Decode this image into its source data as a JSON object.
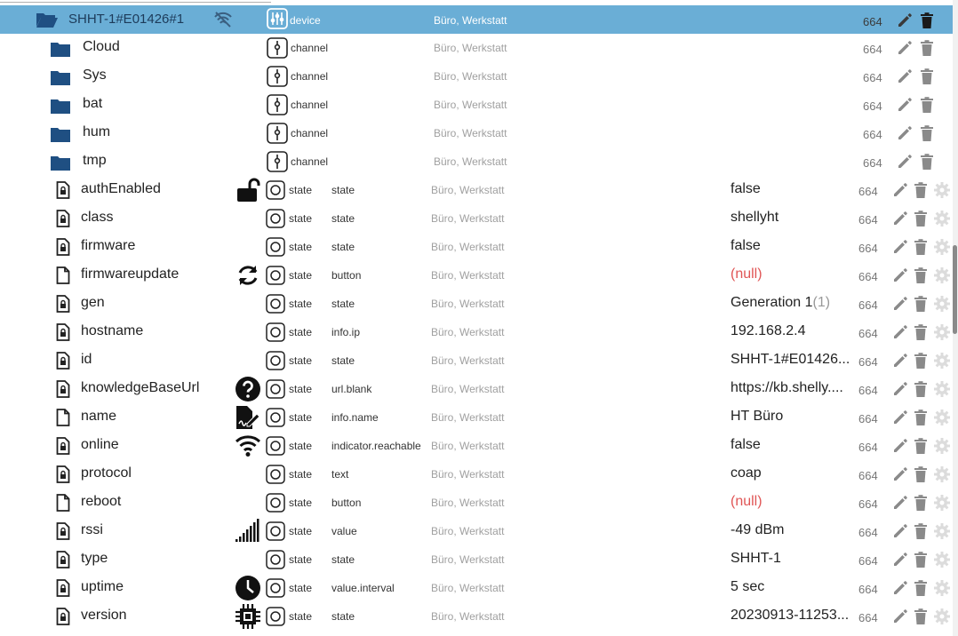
{
  "device": {
    "name": "SHHT-1#E01426#1",
    "type": "device",
    "room": "Büro, Werkstatt",
    "acl": "664"
  },
  "channels": [
    {
      "name": "Cloud",
      "type": "channel",
      "room": "Büro, Werkstatt",
      "acl": "664"
    },
    {
      "name": "Sys",
      "type": "channel",
      "room": "Büro, Werkstatt",
      "acl": "664"
    },
    {
      "name": "bat",
      "type": "channel",
      "room": "Büro, Werkstatt",
      "acl": "664"
    },
    {
      "name": "hum",
      "type": "channel",
      "room": "Büro, Werkstatt",
      "acl": "664"
    },
    {
      "name": "tmp",
      "type": "channel",
      "room": "Büro, Werkstatt",
      "acl": "664"
    }
  ],
  "states": [
    {
      "name": "authEnabled",
      "locked": true,
      "icon": "lock-open-icon",
      "type": "state",
      "role": "state",
      "room": "Büro, Werkstatt",
      "value": "false",
      "value_suffix": "",
      "null": false,
      "acl": "664"
    },
    {
      "name": "class",
      "locked": true,
      "icon": "",
      "type": "state",
      "role": "state",
      "room": "Büro, Werkstatt",
      "value": "shellyht",
      "value_suffix": "",
      "null": false,
      "acl": "664"
    },
    {
      "name": "firmware",
      "locked": true,
      "icon": "",
      "type": "state",
      "role": "state",
      "room": "Büro, Werkstatt",
      "value": "false",
      "value_suffix": "",
      "null": false,
      "acl": "664"
    },
    {
      "name": "firmwareupdate",
      "locked": false,
      "icon": "refresh-icon",
      "type": "state",
      "role": "button",
      "room": "Büro, Werkstatt",
      "value": "(null)",
      "value_suffix": "",
      "null": true,
      "acl": "664"
    },
    {
      "name": "gen",
      "locked": true,
      "icon": "",
      "type": "state",
      "role": "state",
      "room": "Büro, Werkstatt",
      "value": "Generation 1",
      "value_suffix": "(1)",
      "null": false,
      "acl": "664"
    },
    {
      "name": "hostname",
      "locked": true,
      "icon": "",
      "type": "state",
      "role": "info.ip",
      "room": "Büro, Werkstatt",
      "value": "192.168.2.4",
      "value_suffix": "",
      "null": false,
      "acl": "664"
    },
    {
      "name": "id",
      "locked": true,
      "icon": "",
      "type": "state",
      "role": "state",
      "room": "Büro, Werkstatt",
      "value": "SHHT-1#E01426...",
      "value_suffix": "",
      "null": false,
      "acl": "664"
    },
    {
      "name": "knowledgeBaseUrl",
      "locked": true,
      "icon": "help-icon",
      "type": "state",
      "role": "url.blank",
      "room": "Büro, Werkstatt",
      "value": "https://kb.shelly....",
      "value_suffix": "",
      "null": false,
      "acl": "664"
    },
    {
      "name": "name",
      "locked": false,
      "icon": "document-sign-icon",
      "type": "state",
      "role": "info.name",
      "room": "Büro, Werkstatt",
      "value": "HT Büro",
      "value_suffix": "",
      "null": false,
      "acl": "664"
    },
    {
      "name": "online",
      "locked": true,
      "icon": "wifi-icon",
      "type": "state",
      "role": "indicator.reachable",
      "room": "Büro, Werkstatt",
      "value": "false",
      "value_suffix": "",
      "null": false,
      "acl": "664"
    },
    {
      "name": "protocol",
      "locked": true,
      "icon": "",
      "type": "state",
      "role": "text",
      "room": "Büro, Werkstatt",
      "value": "coap",
      "value_suffix": "",
      "null": false,
      "acl": "664"
    },
    {
      "name": "reboot",
      "locked": false,
      "icon": "",
      "type": "state",
      "role": "button",
      "room": "Büro, Werkstatt",
      "value": "(null)",
      "value_suffix": "",
      "null": true,
      "acl": "664"
    },
    {
      "name": "rssi",
      "locked": true,
      "icon": "signal-bars-icon",
      "type": "state",
      "role": "value",
      "room": "Büro, Werkstatt",
      "value": "-49 dBm",
      "value_suffix": "",
      "null": false,
      "acl": "664"
    },
    {
      "name": "type",
      "locked": true,
      "icon": "",
      "type": "state",
      "role": "state",
      "room": "Büro, Werkstatt",
      "value": "SHHT-1",
      "value_suffix": "",
      "null": false,
      "acl": "664"
    },
    {
      "name": "uptime",
      "locked": true,
      "icon": "clock-icon",
      "type": "state",
      "role": "value.interval",
      "room": "Büro, Werkstatt",
      "value": "5 sec",
      "value_suffix": "",
      "null": false,
      "acl": "664"
    },
    {
      "name": "version",
      "locked": true,
      "icon": "chip-icon",
      "type": "state",
      "role": "state",
      "room": "Büro, Werkstatt",
      "value": "20230913-11253...",
      "value_suffix": "",
      "null": false,
      "acl": "664"
    }
  ],
  "colors": {
    "selected_row": "#6aaed6",
    "folder": "#1f4f82",
    "null_value": "#e05555",
    "room_text": "#a0a0a0"
  }
}
